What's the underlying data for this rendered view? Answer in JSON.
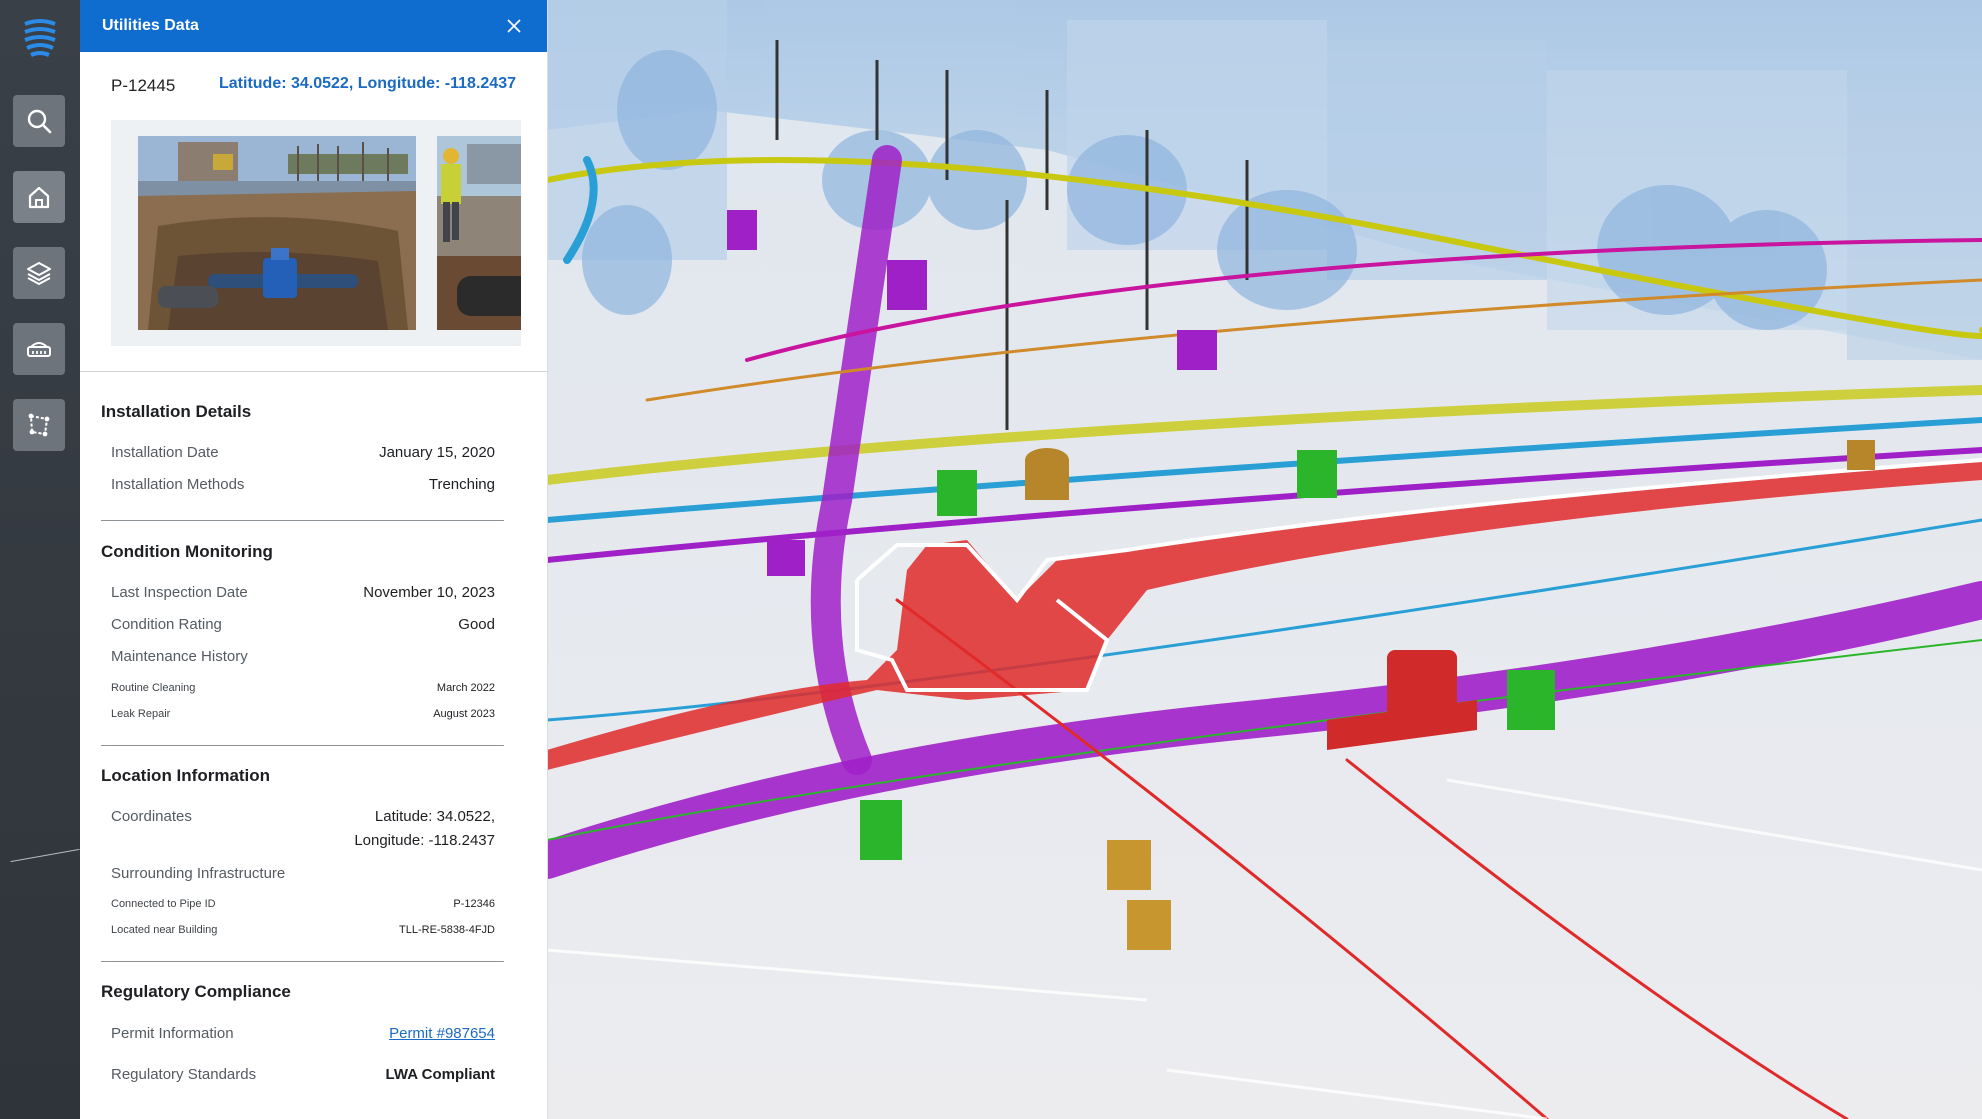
{
  "panel": {
    "title": "Utilities Data",
    "pipe_id": "P-12445",
    "coordinates_link": "Latitude: 34.0522, Longitude: -118.2437",
    "photos": [
      "excavation-site-photo",
      "worker-site-photo"
    ]
  },
  "installation": {
    "title": "Installation Details",
    "rows": [
      {
        "label": "Installation Date",
        "value": "January 15, 2020"
      },
      {
        "label": "Installation Methods",
        "value": "Trenching"
      }
    ]
  },
  "condition": {
    "title": "Condition Monitoring",
    "rows": [
      {
        "label": "Last Inspection Date",
        "value": "November 10, 2023"
      },
      {
        "label": "Condition Rating",
        "value": "Good"
      }
    ],
    "history_label": "Maintenance History",
    "history": [
      {
        "label": "Routine Cleaning",
        "value": "March 2022"
      },
      {
        "label": "Leak Repair",
        "value": "August 2023"
      }
    ]
  },
  "location": {
    "title": "Location Information",
    "coords_label": "Coordinates",
    "coords_line1": "Latitude: 34.0522,",
    "coords_line2": "Longitude: -118.2437",
    "infra_label": "Surrounding Infrastructure",
    "infra": [
      {
        "label": "Connected to Pipe ID",
        "value": "P-12346"
      },
      {
        "label": "Located near Building",
        "value": "TLL-RE-5838-4FJD"
      }
    ]
  },
  "regulatory": {
    "title": "Regulatory Compliance",
    "permit_label": "Permit Information",
    "permit_value": "Permit #987654",
    "standards_label": "Regulatory Standards",
    "standards_value": "LWA Compliant"
  },
  "rail": {
    "icons": [
      "search-icon",
      "home-icon",
      "layers-icon",
      "pipe-inspection-icon",
      "map-measure-icon"
    ]
  },
  "colors": {
    "header_blue": "#0f6dd0",
    "link_blue": "#1b6bc4",
    "selected_pipe": "#e02a2a",
    "pipe_purple": "#a020c8",
    "pipe_cyan": "#2a9fd6",
    "pipe_yellow": "#c8c810",
    "pipe_green": "#2bb52b"
  }
}
